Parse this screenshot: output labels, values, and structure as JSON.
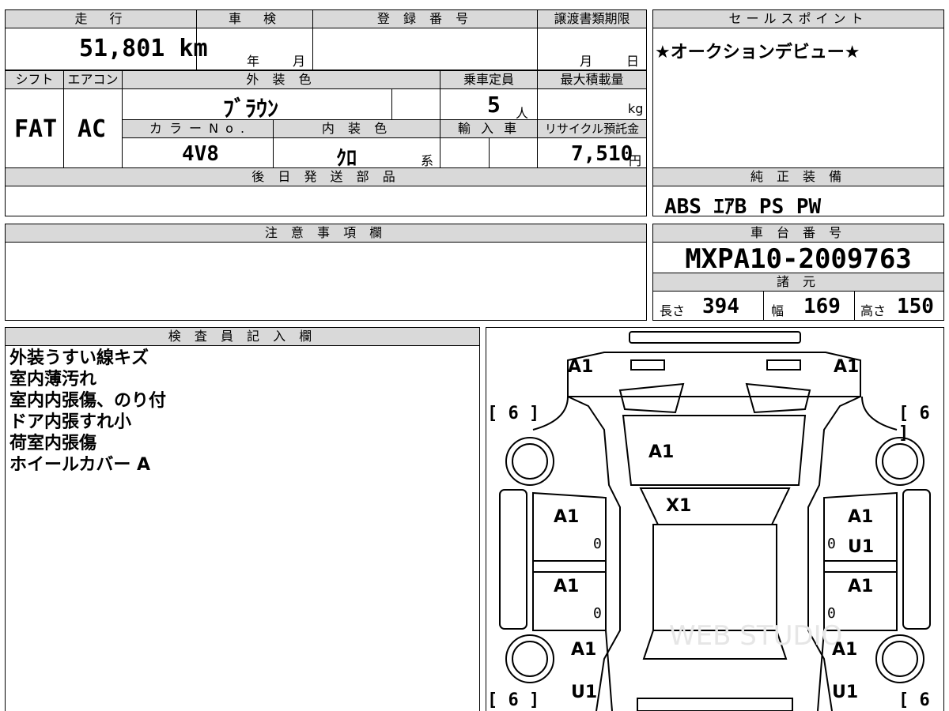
{
  "top_table": {
    "headers": {
      "mileage": "走　行",
      "inspection": "車　検",
      "registration": "登 録 番 号",
      "transfer_deadline": "譲渡書類期限",
      "shift": "シフト",
      "aircon": "エアコン",
      "exterior_color": "外 装 色",
      "capacity": "乗車定員",
      "max_load": "最大積載量",
      "color_no": "カ ラ ー N o .",
      "interior_color": "内 装 色",
      "import": "輸 入 車",
      "recycle_fee": "リサイクル預託金",
      "later_parts": "後 日 発 送 部 品"
    },
    "values": {
      "mileage": "51,801 km",
      "inspection_year_unit": "年",
      "inspection_month_unit": "月",
      "transfer_month_unit": "月",
      "transfer_day_unit": "日",
      "shift": "FAT",
      "aircon": "AC",
      "exterior_color": "ﾌﾞﾗｳﾝ",
      "capacity": "5",
      "capacity_unit": "人",
      "load_unit": "kg",
      "color_no": "4V8",
      "interior_color": "ｸﾛ",
      "interior_suffix": "系",
      "recycle_fee": "7,510",
      "recycle_unit": "円"
    }
  },
  "sales_point": {
    "header": "セールスポイント",
    "text": "★オークションデビュー★"
  },
  "equipment": {
    "header": "純 正 装 備",
    "text": "ABS ｴｱB PS PW"
  },
  "caution": {
    "header": "注 意 事 項 欄"
  },
  "chassis": {
    "header": "車 台 番 号",
    "number": "MXPA10-2009763",
    "specs_header": "諸 元",
    "length_label": "長さ",
    "length": "394",
    "width_label": "幅",
    "width": "169",
    "height_label": "高さ",
    "height": "150"
  },
  "inspector": {
    "header": "検 査 員 記 入 欄",
    "lines": [
      "外装うすい線キズ",
      "室内薄汚れ",
      "室内内張傷、のり付",
      "ドア内張すれ小",
      "荷室内張傷",
      "ホイールカバー A"
    ]
  },
  "diagram": {
    "marks": {
      "front_left": "A1",
      "front_right": "A1",
      "hood": "A1",
      "windshield": "X1",
      "fl_door": "A1",
      "fr_door_a": "A1",
      "fr_door_u": "U1",
      "rl_door": "A1",
      "rr_door": "A1",
      "rear_left": "A1",
      "rear_left_u": "U1",
      "rear_right": "A1",
      "rear_right_u": "U1",
      "zero": "0"
    },
    "tire": "[ 6 ]",
    "watermark": "WEB STUDIO"
  }
}
